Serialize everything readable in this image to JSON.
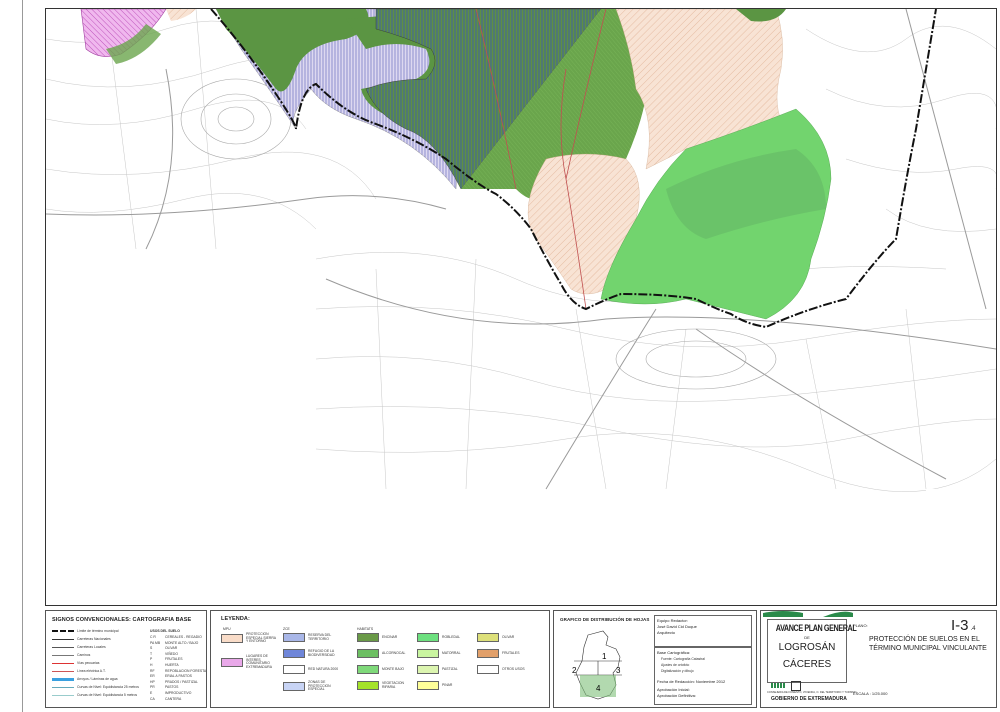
{
  "signos": {
    "title": "SIGNOS CONVENCIONALES: CARTOGRAFIA BASE",
    "lines": [
      "Límite de término municipal",
      "Carreteras Nacionales",
      "Carreteras Locales",
      "Caminos",
      "Vías pecuarias",
      "Línea eléctrica A.T.",
      "Arroyos / Láminas de agua",
      "Curvas de Nivel: Equidistancia 25 metros",
      "Curvas de Nivel: Equidistancia 5 metros"
    ],
    "uses_title": "USOS DEL SUELO",
    "uses": [
      {
        "code": "C   R",
        "name": "CEREALES - REGADIO"
      },
      {
        "code": "PA   MB",
        "name": "MONTE ALTO / BAJO"
      },
      {
        "code": "S",
        "name": "OLIVAR"
      },
      {
        "code": "T",
        "name": "VIÑEDO"
      },
      {
        "code": "P",
        "name": "FRUTALES"
      },
      {
        "code": "H",
        "name": "HUERTA"
      },
      {
        "code": "RF",
        "name": "REPOBLACION FORESTAL"
      },
      {
        "code": "ER",
        "name": "ERIAL A PASTOS"
      },
      {
        "code": "HP",
        "name": "PRADOS / PASTIZAL"
      },
      {
        "code": "PR",
        "name": "PASTOS"
      },
      {
        "code": "E",
        "name": "IMPRODUCTIVO"
      },
      {
        "code": "CA",
        "name": "CANTERA"
      }
    ]
  },
  "leyenda": {
    "title": "LEYENDA:",
    "sub_a": "MPU",
    "sub_b": "ZCE",
    "sub_c": "HABITATS",
    "mpu": [
      {
        "label": "PROTECCION ESPECIAL SIERRA Y ENTORNO",
        "color": "#f9dcc8"
      },
      {
        "label": "LUGARES DE INTERES COMUNITARIO EXTREMADURA",
        "color": "#e9a8e9"
      }
    ],
    "zce": [
      {
        "label": "RESERVA DEL TERRITORIO",
        "color": "#a9b7e8"
      },
      {
        "label": "REFUGIO DE LA BIODIVERSIDAD",
        "color": "#6f86d9"
      },
      {
        "label": "RED NATURA 2000",
        "color": "#ffffff"
      },
      {
        "label": "ZONAS DE PROTECCION ESPECIAL",
        "color": "#c8d4f5"
      }
    ],
    "habitats": [
      {
        "label": "ENCINAR",
        "color": "#6a9a48"
      },
      {
        "label": "ALCORNOCAL",
        "color": "#6cbf62"
      },
      {
        "label": "MONTE BAJO",
        "color": "#7fd97a"
      },
      {
        "label": "VEGETACION RIPARIA",
        "color": "#a4e22a"
      },
      {
        "label": "ROBLEDAL",
        "color": "#6de07f"
      },
      {
        "label": "MATORRAL",
        "color": "#c9f5a0"
      },
      {
        "label": "PASTIZAL",
        "color": "#dcf5b0"
      },
      {
        "label": "PINAR",
        "color": "#ffff99"
      },
      {
        "label": "OLIVAR",
        "color": "#dde07a"
      },
      {
        "label": "FRUTALES",
        "color": "#e2a06a"
      },
      {
        "label": "OTROS USOS",
        "color": "#ffffff"
      }
    ]
  },
  "grafico": {
    "title": "GRAFICO DE DISTRIBUCIÓN DE HOJAS",
    "sheets": [
      "1",
      "2",
      "3",
      "4"
    ]
  },
  "info": {
    "equipo_label": "Equipo Redactor:",
    "equipo_name": "José David Cid Duque",
    "equipo_role": "Arquitecto",
    "base_label": "Base Cartográfica:",
    "base_items": [
      "Fuente: Cartografía Catastral",
      "Ajustes de ortofoto",
      "Digitalización y dibujo"
    ],
    "fecha": "Fecha de Redacción: Noviembre 2012",
    "aprob_inicial": "Aprobación Inicial:",
    "aprob_definitiva": "Aprobación Definitiva:"
  },
  "title_block": {
    "plan": "AVANCE PLAN GENERAL",
    "de": "DE",
    "municipio": "LOGROSÁN",
    "provincia": "CÁCERES",
    "consejeria": "CONSEJERIA DE FOMENTO, VIVIENDA, O. DEL TERRITORIO Y TURISMO",
    "gobierno": "GOBIERNO DE EXTREMADURA",
    "plano_label": "PLANO:",
    "plano_num": "I-3",
    "plano_sub": ".4",
    "plano_title_1": "PROTECCIÓN DE SUELOS EN EL",
    "plano_title_2": "TÉRMINO MUNICIPAL VINCULANTE",
    "escala": "ESCALA : 1/25.000"
  }
}
